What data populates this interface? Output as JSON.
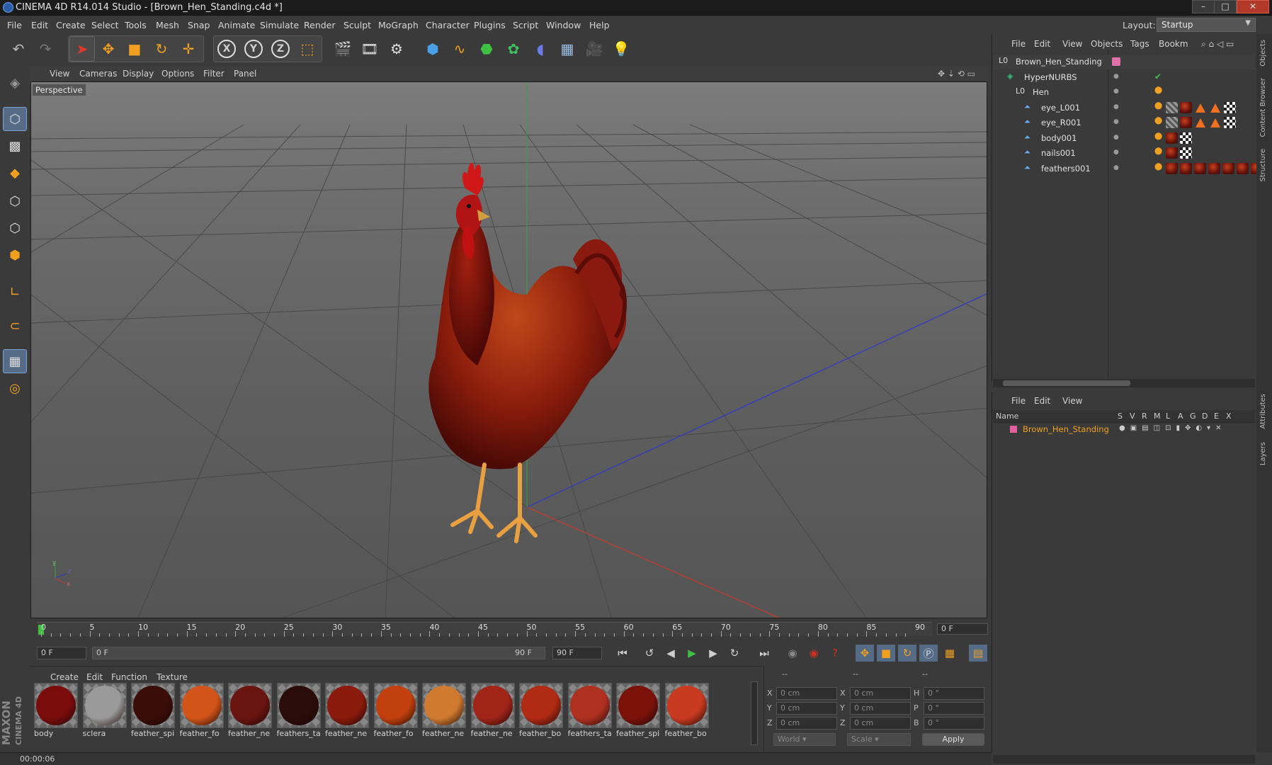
{
  "window": {
    "title": "CINEMA 4D R14.014 Studio - [Brown_Hen_Standing.c4d *]",
    "minimize": "–",
    "maximize": "□",
    "close": "✕"
  },
  "menubar": {
    "items": [
      "File",
      "Edit",
      "Create",
      "Select",
      "Tools",
      "Mesh",
      "Snap",
      "Animate",
      "Simulate",
      "Render",
      "Sculpt",
      "MoGraph",
      "Character",
      "Plugins",
      "Script",
      "Window",
      "Help"
    ]
  },
  "layout": {
    "label": "Layout:",
    "value": "Startup"
  },
  "viewport": {
    "menu": [
      "View",
      "Cameras",
      "Display",
      "Options",
      "Filter",
      "Panel"
    ],
    "label": "Perspective",
    "axis_x": "x",
    "axis_y": "y",
    "axis_z": "z"
  },
  "timeline": {
    "ticks": [
      "0",
      "5",
      "10",
      "15",
      "20",
      "25",
      "30",
      "35",
      "40",
      "45",
      "50",
      "55",
      "60",
      "65",
      "70",
      "75",
      "80",
      "85",
      "90"
    ],
    "current_frame": "0 F",
    "start_field": "0 F",
    "range_start": "0 F",
    "range_end": "90 F",
    "end_field": "90 F"
  },
  "materials": {
    "menu": [
      "Create",
      "Edit",
      "Function",
      "Texture"
    ],
    "items": [
      {
        "name": "body",
        "color": "#7a0c0c"
      },
      {
        "name": "sclera",
        "color": "#9a9a9a"
      },
      {
        "name": "feather_spi",
        "color": "#3a0d08"
      },
      {
        "name": "feather_fo",
        "color": "#d25418"
      },
      {
        "name": "feather_ne",
        "color": "#6a1410"
      },
      {
        "name": "feathers_ta",
        "color": "#2a0d0a"
      },
      {
        "name": "feather_ne",
        "color": "#8a1a0c"
      },
      {
        "name": "feather_fo",
        "color": "#c2400e"
      },
      {
        "name": "feather_ne",
        "color": "#d07a30"
      },
      {
        "name": "feather_ne",
        "color": "#a02418"
      },
      {
        "name": "feather_bo",
        "color": "#b02a14"
      },
      {
        "name": "feathers_ta",
        "color": "#b03020"
      },
      {
        "name": "feather_spi",
        "color": "#7a120a"
      },
      {
        "name": "feather_bo",
        "color": "#c83a20"
      }
    ]
  },
  "coords": {
    "headers": [
      "--",
      "--",
      "--"
    ],
    "rows": [
      {
        "a": "X",
        "av": "0 cm",
        "b": "X",
        "bv": "0 cm",
        "c": "H",
        "cv": "0 °"
      },
      {
        "a": "Y",
        "av": "0 cm",
        "b": "Y",
        "bv": "0 cm",
        "c": "P",
        "cv": "0 °"
      },
      {
        "a": "Z",
        "av": "0 cm",
        "b": "Z",
        "bv": "0 cm",
        "c": "B",
        "cv": "0 °"
      }
    ],
    "mode": "World",
    "scale": "Scale",
    "apply": "Apply"
  },
  "status": {
    "time": "00:00:06"
  },
  "object_manager": {
    "menu": [
      "File",
      "Edit",
      "View",
      "Objects",
      "Tags",
      "Bookm"
    ],
    "objects": [
      {
        "name": "Brown_Hen_Standing",
        "indent": 0
      },
      {
        "name": "HyperNURBS",
        "indent": 1
      },
      {
        "name": "Hen",
        "indent": 2
      },
      {
        "name": "eye_L001",
        "indent": 3
      },
      {
        "name": "eye_R001",
        "indent": 3
      },
      {
        "name": "body001",
        "indent": 3
      },
      {
        "name": "nails001",
        "indent": 3
      },
      {
        "name": "feathers001",
        "indent": 3
      }
    ]
  },
  "layer_manager": {
    "menu": [
      "File",
      "Edit",
      "View"
    ],
    "col_name": "Name",
    "cols": [
      "S",
      "V",
      "R",
      "M",
      "L",
      "A",
      "G",
      "D",
      "E",
      "X"
    ],
    "layer": "Brown_Hen_Standing"
  },
  "side_tabs": [
    "Objects",
    "Content Browser",
    "Structure",
    "Attributes",
    "Layers"
  ],
  "brand": {
    "text1": "MAXON",
    "text2": "CINEMA 4D"
  },
  "colors": {
    "accent_orange": "#f0a020",
    "layer_pink": "#e060a0",
    "selection_blue": "#556b86",
    "play_green": "#40c040"
  }
}
